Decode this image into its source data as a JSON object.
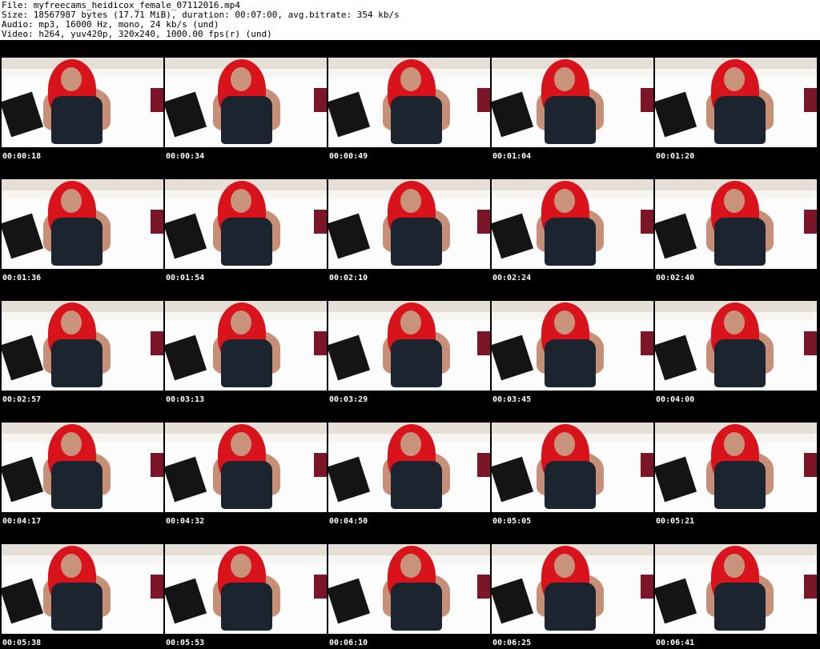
{
  "header": {
    "file": "File: myfreecams_heidicox_female_07112016.mp4",
    "size": "Size: 18567987 bytes (17.71 MiB), duration: 00:07:00, avg.bitrate: 354 kb/s",
    "audio": "Audio: mp3, 16000 Hz, mono, 24 kb/s (und)",
    "video": "Video: h264, yuv420p, 320x240, 1000.00 fps(r) (und)"
  },
  "thumbnails": [
    "00:00:18",
    "00:00:34",
    "00:00:49",
    "00:01:04",
    "00:01:20",
    "00:01:36",
    "00:01:54",
    "00:02:10",
    "00:02:24",
    "00:02:40",
    "00:02:57",
    "00:03:13",
    "00:03:29",
    "00:03:45",
    "00:04:00",
    "00:04:17",
    "00:04:32",
    "00:04:50",
    "00:05:05",
    "00:05:21",
    "00:05:38",
    "00:05:53",
    "00:06:10",
    "00:06:25",
    "00:06:41"
  ],
  "colors": {
    "sheet_background": "#000000",
    "header_background": "#ffffff",
    "timestamp_text": "#ffffff",
    "hair": "#d8131c"
  }
}
